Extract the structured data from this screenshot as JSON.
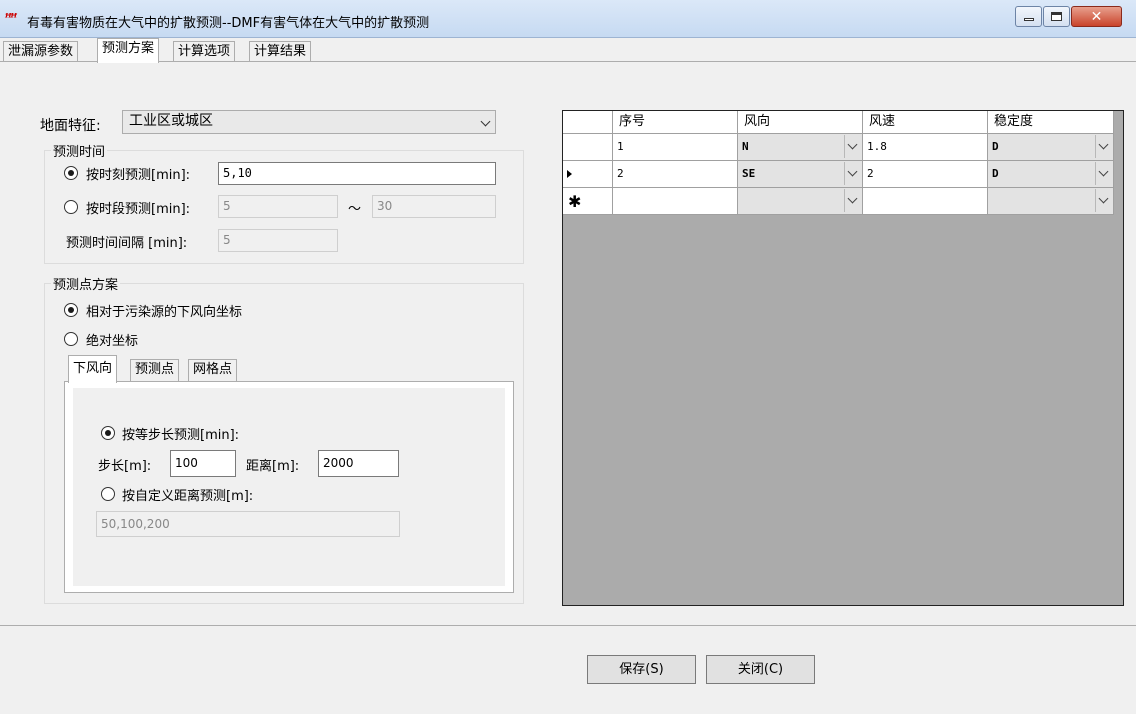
{
  "window": {
    "title": "有毒有害物质在大气中的扩散预测--DMF有害气体在大气中的扩散预测",
    "icon_glyph": "ꟸꟸ",
    "close_glyph": "✕"
  },
  "tabs": [
    "泄漏源参数",
    "预测方案",
    "计算选项",
    "计算结果"
  ],
  "ground": {
    "label": "地面特征:",
    "value": "工业区或城区"
  },
  "prediction_time": {
    "title": "预测时间",
    "by_moment": {
      "label": "按时刻预测[min]:",
      "value": "5,10",
      "checked": true
    },
    "by_period": {
      "label": "按时段预测[min]:",
      "from": "5",
      "separator": "～",
      "to": "30",
      "checked": false
    },
    "interval": {
      "label": "预测时间间隔 [min]:",
      "value": "5"
    }
  },
  "point_scheme": {
    "title": "预测点方案",
    "relative": {
      "label": "相对于污染源的下风向坐标",
      "checked": true
    },
    "absolute": {
      "label": "绝对坐标",
      "checked": false
    },
    "subtabs": [
      "下风向",
      "预测点",
      "网格点"
    ],
    "equal_step": {
      "label": "按等步长预测[min]:",
      "checked": true
    },
    "step": {
      "label": "步长[m]:",
      "value": "100"
    },
    "distance": {
      "label": "距离[m]:",
      "value": "2000"
    },
    "custom": {
      "label": "按自定义距离预测[m]:",
      "checked": false,
      "value": "50,100,200"
    }
  },
  "grid": {
    "columns": [
      "序号",
      "风向",
      "风速",
      "稳定度"
    ],
    "rows": [
      {
        "no": "1",
        "dir": "N",
        "speed": "1.8",
        "stability": "D"
      },
      {
        "no": "2",
        "dir": "SE",
        "speed": "2",
        "stability": "D"
      }
    ],
    "new_row_marker": "✱"
  },
  "buttons": {
    "save": "保存(S)",
    "close": "关闭(C)"
  }
}
